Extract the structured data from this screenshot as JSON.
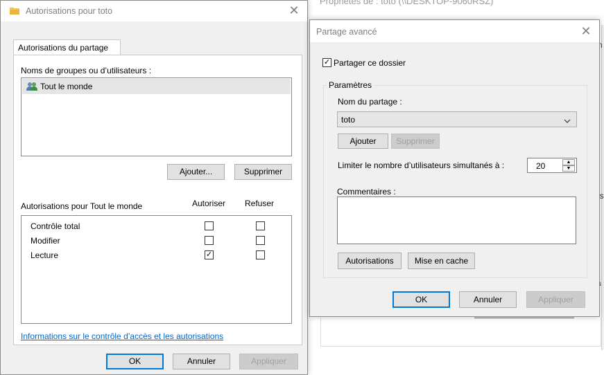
{
  "background": {
    "title_fragment": "Propriétés de : toto (\\\\DESKTOP-9060RSZ)",
    "side_letters": [
      "n",
      "es",
      "a"
    ]
  },
  "perm_dialog": {
    "title": "Autorisations pour toto",
    "tab": "Autorisations du partage",
    "groups_label": "Noms de groupes ou d’utilisateurs :",
    "group_items": [
      "Tout le monde"
    ],
    "add_label": "Ajouter...",
    "remove_label": "Supprimer",
    "perm_for_label": "Autorisations pour Tout le monde",
    "col_allow": "Autoriser",
    "col_deny": "Refuser",
    "perms": [
      {
        "name": "Contrôle total",
        "allow": false,
        "deny": false
      },
      {
        "name": "Modifier",
        "allow": false,
        "deny": false
      },
      {
        "name": "Lecture",
        "allow": true,
        "deny": false
      }
    ],
    "info_link": "Informations sur le contrôle d’accès et les autorisations",
    "ok_label": "OK",
    "cancel_label": "Annuler",
    "apply_label": "Appliquer"
  },
  "share_dialog": {
    "title": "Partage avancé",
    "share_checkbox_label": "Partager ce dossier",
    "share_checked": true,
    "params_label": "Paramètres",
    "share_name_label": "Nom du partage :",
    "share_name_value": "toto",
    "add_label": "Ajouter",
    "remove_label": "Supprimer",
    "limit_label": "Limiter le nombre d’utilisateurs simultanés à :",
    "limit_value": "20",
    "comments_label": "Commentaires :",
    "comments_value": "",
    "permissions_label": "Autorisations",
    "caching_label": "Mise en cache",
    "ok_label": "OK",
    "cancel_label": "Annuler",
    "apply_label": "Appliquer"
  },
  "icons": {
    "folder": "folder-icon",
    "users": "users-icon",
    "close": "close-icon",
    "check": "✓"
  }
}
